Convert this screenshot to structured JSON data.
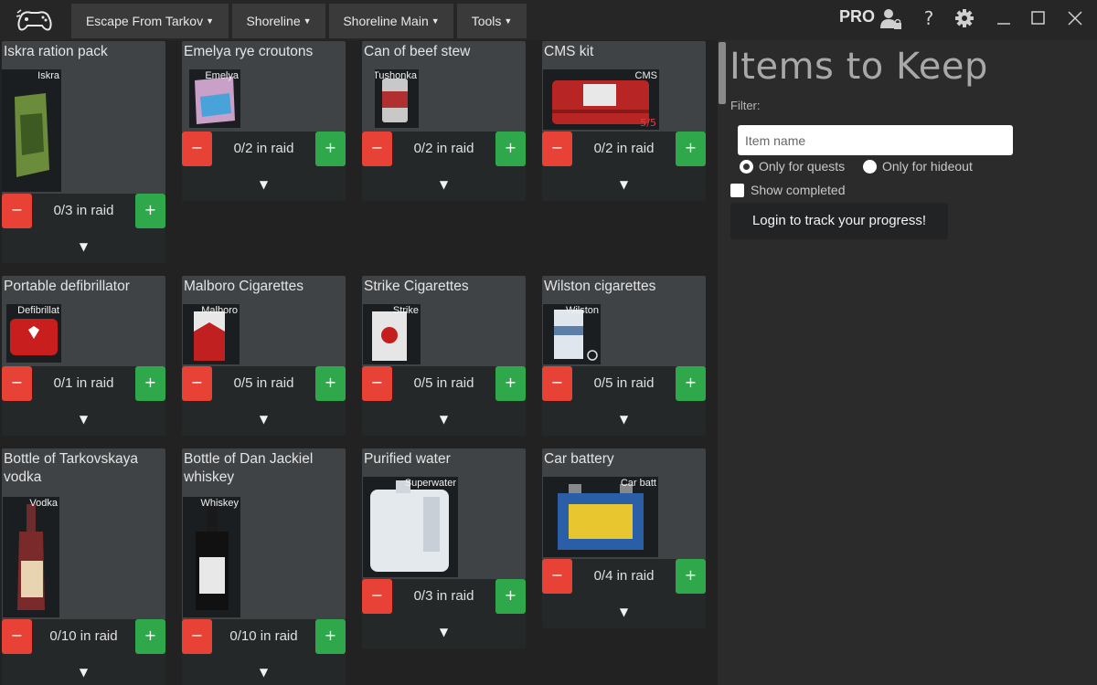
{
  "titlebar": {
    "menus": [
      {
        "label": "Escape From Tarkov"
      },
      {
        "label": "Shoreline"
      },
      {
        "label": "Shoreline Main"
      },
      {
        "label": "Tools"
      }
    ],
    "pro_label": "PRO"
  },
  "items": [
    {
      "name": "Iskra ration pack",
      "thumb_label": "Iskra",
      "count": "0/3 in raid"
    },
    {
      "name": "Emelya rye croutons",
      "thumb_label": "Emelya",
      "count": "0/2 in raid"
    },
    {
      "name": "Can of beef stew",
      "thumb_label": "Tushonka",
      "count": "0/2 in raid"
    },
    {
      "name": "CMS kit",
      "thumb_label": "CMS",
      "thumb_sub": "5/5",
      "count": "0/2 in raid"
    },
    {
      "name": "Portable defibrillator",
      "thumb_label": "Defibrillat",
      "count": "0/1 in raid"
    },
    {
      "name": "Malboro Cigarettes",
      "thumb_label": "Malboro",
      "count": "0/5 in raid"
    },
    {
      "name": "Strike Cigarettes",
      "thumb_label": "Strike",
      "count": "0/5 in raid"
    },
    {
      "name": "Wilston cigarettes",
      "thumb_label": "Wilston",
      "count": "0/5 in raid"
    },
    {
      "name": "Bottle of Tarkovskaya vodka",
      "thumb_label": "Vodka",
      "count": "0/10 in raid"
    },
    {
      "name": "Bottle of Dan Jackiel whiskey",
      "thumb_label": "Whiskey",
      "count": "0/10 in raid"
    },
    {
      "name": "Purified water",
      "thumb_label": "Superwater",
      "count": "0/3 in raid"
    },
    {
      "name": "Car battery",
      "thumb_label": "Car batt",
      "count": "0/4 in raid"
    }
  ],
  "buttons": {
    "minus": "−",
    "plus": "+",
    "expand": "▼"
  },
  "panel": {
    "title": "Items to Keep",
    "filter_label": "Filter:",
    "filter_placeholder": "Item name",
    "radio_quests": "Only for quests",
    "radio_hideout": "Only for hideout",
    "show_completed": "Show completed",
    "login": "Login to track your progress!"
  },
  "colors": {
    "minus": "#e84236",
    "plus": "#2ea84a",
    "card": "#3f4346",
    "background": "#2b2b2b"
  },
  "icons": [
    "gamepad-logo-icon",
    "user-lock-icon",
    "help-icon",
    "gear-icon",
    "minimize-icon",
    "maximize-icon",
    "close-icon"
  ]
}
